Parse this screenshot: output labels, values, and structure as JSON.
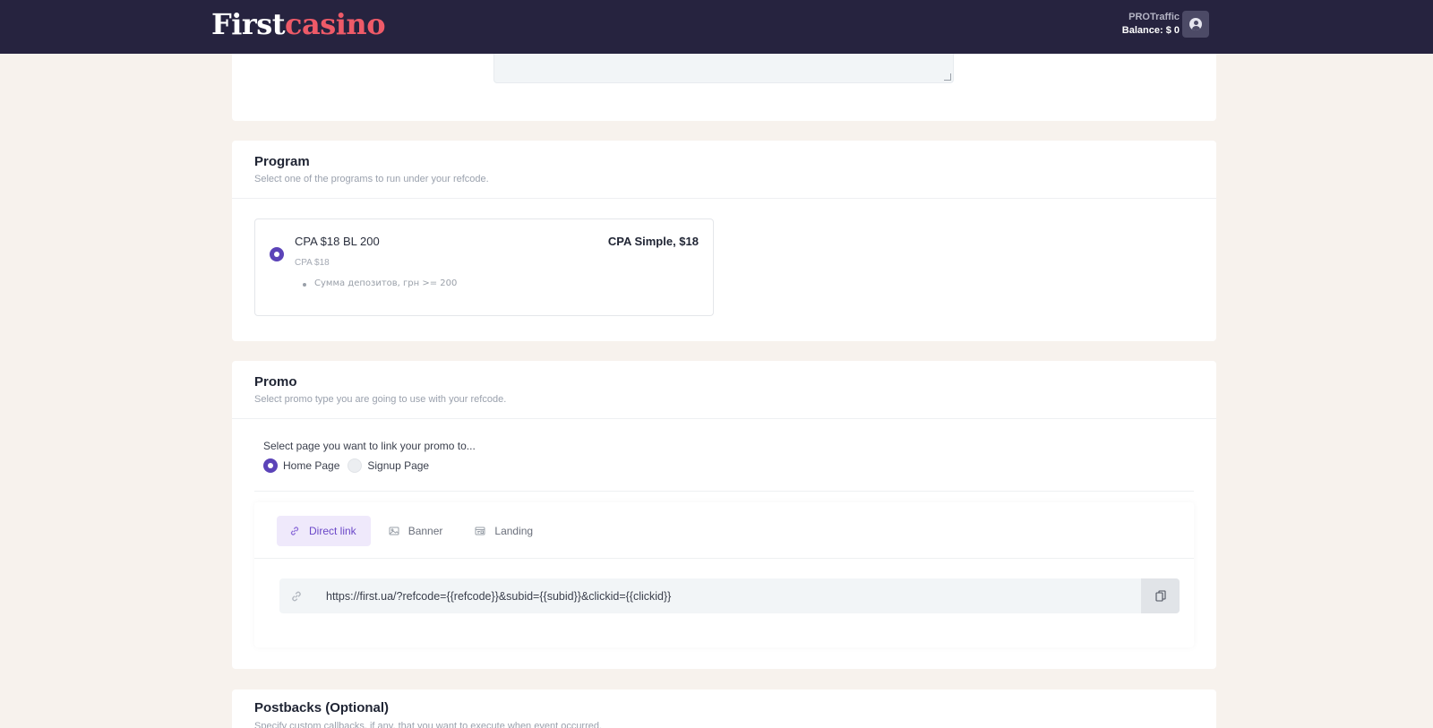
{
  "header": {
    "logo_part1": "First",
    "logo_part2": "casino",
    "account_name": "PROTraffic",
    "balance": "Balance: $ 0",
    "colors": {
      "bar": "#26233f",
      "logo_accent": "#ee5a68"
    }
  },
  "program": {
    "title": "Program",
    "subtitle": "Select one of the programs to run under your refcode.",
    "option": {
      "name": "CPA $18 BL 200",
      "type": "CPA Simple, $18",
      "cpa": "CPA $18",
      "condition": "Сумма депозитов, грн >= 200",
      "selected": true
    }
  },
  "promo": {
    "title": "Promo",
    "subtitle": "Select promo type you are going to use with your refcode.",
    "page_label": "Select page you want to link your promo to...",
    "pages": [
      {
        "label": "Home Page",
        "selected": true
      },
      {
        "label": "Signup Page",
        "selected": false
      }
    ],
    "tabs": [
      {
        "label": "Direct link",
        "icon": "link-icon",
        "active": true
      },
      {
        "label": "Banner",
        "icon": "image-icon",
        "active": false
      },
      {
        "label": "Landing",
        "icon": "landing-icon",
        "active": false
      }
    ],
    "url": "https://first.ua/?refcode={{refcode}}&subid={{subid}}&clickid={{clickid}}"
  },
  "postbacks": {
    "title": "Postbacks (Optional)",
    "subtitle": "Specify custom callbacks, if any, that you want to execute when event occurred."
  },
  "accent_color": "#5b43b8"
}
